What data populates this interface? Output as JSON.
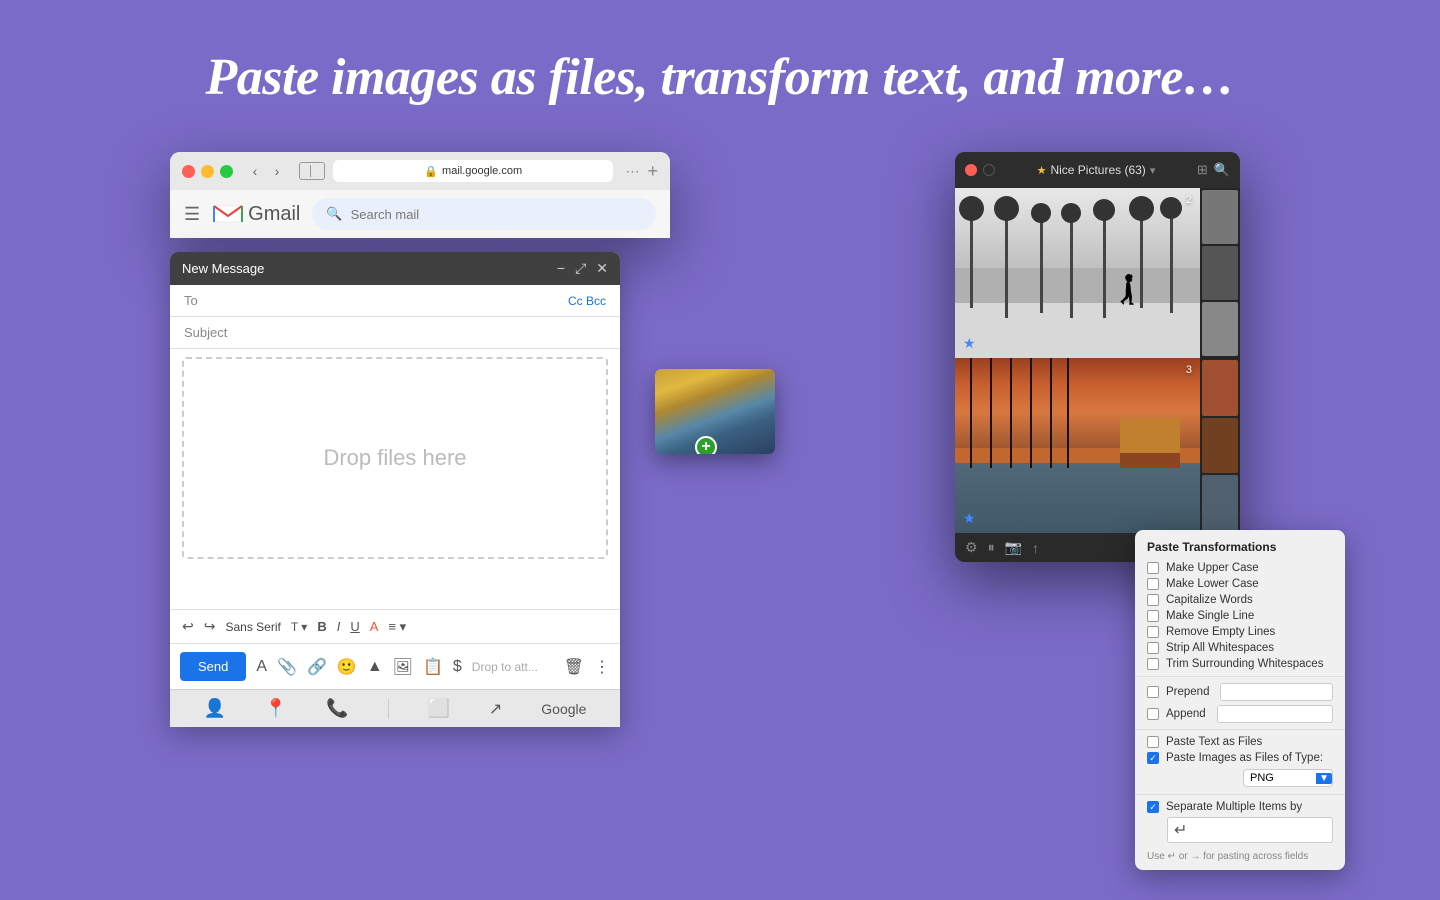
{
  "page": {
    "background_color": "#7b6bc8",
    "title": "Paste images as files, transform text, and more…"
  },
  "gmail_window": {
    "url": "mail.google.com",
    "wordmark": "Gmail",
    "search_placeholder": "Search mail",
    "compose": {
      "title": "New Message",
      "to_label": "To",
      "cc_label": "Cc Bcc",
      "subject_label": "Subject",
      "drop_text": "Drop files here",
      "send_btn": "Send",
      "drop_attach": "Drop to att...",
      "font": "Sans Serif"
    }
  },
  "photos_window": {
    "title": "Nice Pictures (63)",
    "photo1_number": "2",
    "photo2_number": "3"
  },
  "paste_popup": {
    "title": "Paste Transformations",
    "options": [
      {
        "label": "Make Upper Case",
        "checked": false
      },
      {
        "label": "Make Lower Case",
        "checked": false
      },
      {
        "label": "Capitalize Words",
        "checked": false
      },
      {
        "label": "Make Single Line",
        "checked": false
      },
      {
        "label": "Remove Empty Lines",
        "checked": false
      },
      {
        "label": "Strip All Whitespaces",
        "checked": false
      },
      {
        "label": "Trim Surrounding Whitespaces",
        "checked": false
      },
      {
        "label": "Prepend",
        "checked": false
      },
      {
        "label": "Append",
        "checked": false
      },
      {
        "label": "Paste Text as Files",
        "checked": false
      },
      {
        "label": "Paste Images as Files of Type:",
        "checked": true
      }
    ],
    "file_type": "PNG",
    "separate_label": "Separate Multiple Items by",
    "footer_hint": "Use ↵ or → for pasting across fields"
  }
}
